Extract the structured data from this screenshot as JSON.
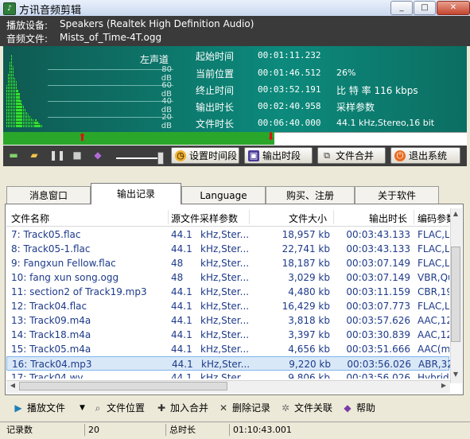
{
  "window": {
    "title": "方讯音频剪辑",
    "min": "_",
    "max": "□",
    "close": "✕"
  },
  "info": {
    "device_label": "播放设备:",
    "device": "Speakers (Realtek High Definition Audio)",
    "file_label": "音频文件:",
    "file": "Mists_of_Time-4T.ogg"
  },
  "meter": {
    "channel": "左声道",
    "db": [
      "80 dB",
      "60 dB",
      "40 dB",
      "20 dB"
    ],
    "levels": [
      0.55,
      0.7,
      0.85,
      0.95,
      0.8,
      0.65,
      0.6,
      0.5,
      0.45,
      0.35,
      0.3,
      0.28,
      0.25,
      0.2,
      0.18,
      0.15,
      0.12,
      0.1,
      0.08,
      0.1,
      0.08,
      0.05,
      0.04,
      0.03
    ],
    "colors": {
      "active": "#33e033",
      "dim": "#1a6a1a"
    }
  },
  "times": [
    {
      "label": "起始时间",
      "value": "00:01:11.232",
      "extra": ""
    },
    {
      "label": "当前位置",
      "value": "00:01:46.512",
      "extra": "26%"
    },
    {
      "label": "终止时间",
      "value": "00:03:52.191",
      "extra": "比 特 率   116 kbps"
    },
    {
      "label": "输出时长",
      "value": "00:02:40.958",
      "extra": "采样参数"
    },
    {
      "label": "文件时长",
      "value": "00:06:40.000",
      "extra": "44.1  kHz,Stereo,16 bit"
    }
  ],
  "progress": {
    "fraction": 0.26,
    "up": "⬆",
    "down": "⬇"
  },
  "toolbar": {
    "set_time": "设置时间段",
    "output": "输出时段",
    "merge": "文件合并",
    "exit": "退出系统"
  },
  "tabs": [
    "消息窗口",
    "输出记录",
    "Language",
    "购买、注册",
    "关于软件"
  ],
  "list": {
    "headers": [
      "文件名称",
      "源文件采样参数",
      "文件大小",
      "输出时长",
      "编码参数"
    ],
    "rows": [
      {
        "name": "7: Track05.flac",
        "rate": "44.1",
        "params": "kHz,Ster...",
        "size": "18,957 kb",
        "dur": "00:03:43.133",
        "codec": "FLAC,Le"
      },
      {
        "name": "8: Track05-1.flac",
        "rate": "44.1",
        "params": "kHz,Ster...",
        "size": "22,741 kb",
        "dur": "00:03:43.133",
        "codec": "FLAC,Le"
      },
      {
        "name": "9: Fangxun Fellow.flac",
        "rate": "48",
        "params": "kHz,Ster...",
        "size": "18,187 kb",
        "dur": "00:03:07.149",
        "codec": "FLAC,Le"
      },
      {
        "name": "10: fang xun song.ogg",
        "rate": "48",
        "params": "kHz,Ster...",
        "size": "3,029 kb",
        "dur": "00:03:07.149",
        "codec": "VBR,Qu"
      },
      {
        "name": "11: section2 of  Track19.mp3",
        "rate": "44.1",
        "params": "kHz,Ster...",
        "size": "4,480 kb",
        "dur": "00:03:11.159",
        "codec": "CBR,192"
      },
      {
        "name": "12: Track04.flac",
        "rate": "44.1",
        "params": "kHz,Ster...",
        "size": "16,429 kb",
        "dur": "00:03:07.773",
        "codec": "FLAC,Le"
      },
      {
        "name": "13: Track09.m4a",
        "rate": "44.1",
        "params": "kHz,Ster...",
        "size": "3,818 kb",
        "dur": "00:03:57.626",
        "codec": "AAC,128"
      },
      {
        "name": "14: Track18.m4a",
        "rate": "44.1",
        "params": "kHz,Ster...",
        "size": "3,397 kb",
        "dur": "00:03:30.839",
        "codec": "AAC,128"
      },
      {
        "name": "15: Track05.m4a",
        "rate": "44.1",
        "params": "kHz,Ster...",
        "size": "4,656 kb",
        "dur": "00:03:51.666",
        "codec": "AAC(ms"
      },
      {
        "name": "16: Track04.mp3",
        "rate": "44.1",
        "params": "kHz,Ster...",
        "size": "9,220 kb",
        "dur": "00:03:56.026",
        "codec": "ABR,32"
      },
      {
        "name": "17: Track04.wv",
        "rate": "44.1",
        "params": "kHz,Ster...",
        "size": "9,806 kb",
        "dur": "00:03:56.026",
        "codec": "Hybrid 1"
      }
    ],
    "selected_index": 9
  },
  "actions": {
    "play": "播放文件",
    "location": "文件位置",
    "add_merge": "加入合并",
    "delete": "删除记录",
    "assoc": "文件关联",
    "help": "帮助"
  },
  "status": {
    "count_label": "记录数",
    "count": "20",
    "total_label": "总时长",
    "total": "01:10:43.001"
  }
}
